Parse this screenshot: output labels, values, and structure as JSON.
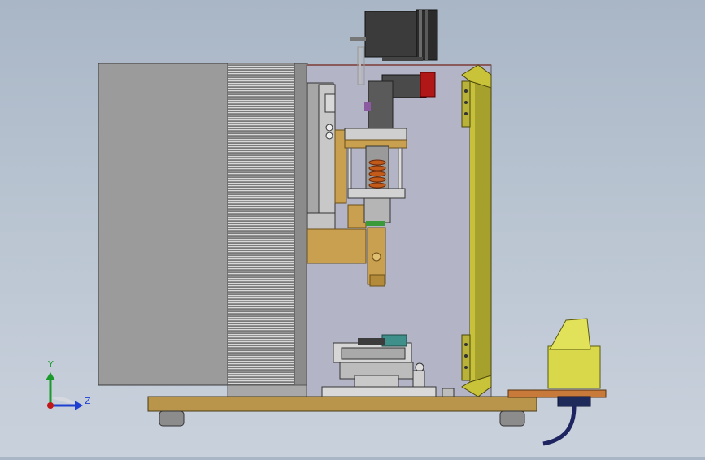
{
  "viewport": {
    "background_top": "#a9b6c6",
    "background_bottom": "#c9d1dc"
  },
  "triad": {
    "y_label": "Y",
    "z_label": "Z",
    "y_color": "#1a9a2a",
    "z_color": "#1e3fd0",
    "origin_color": "#c01818"
  },
  "colors": {
    "base_plate": "#b8954a",
    "brass": "#c9a04f",
    "yellow_guard": "#a6a02c",
    "foot_switch": "#d8d84a",
    "enclosure_gray": "#9a9a9a",
    "glass": "#b3b5c6",
    "motor": "#3a3a3a",
    "red_knob": "#b01818",
    "cable": "#1d2460"
  },
  "components": [
    "housing-panel-icon",
    "heat-sink-icon",
    "transparent-guard-icon",
    "servo-motor-icon",
    "press-ram-icon",
    "fixture-table-icon",
    "guard-rail-icon",
    "foot-pedal-icon",
    "base-plate-icon"
  ]
}
